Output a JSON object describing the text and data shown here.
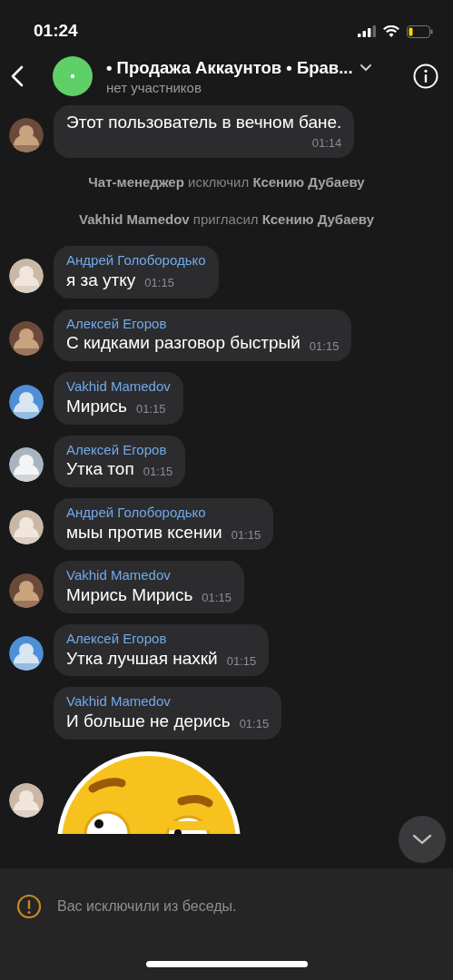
{
  "status_bar": {
    "time": "01:24"
  },
  "header": {
    "title": "• Продажа Аккаунтов • Брав...",
    "subtitle": "нет участников"
  },
  "messages": [
    {
      "kind": "text",
      "text": "Этот пользователь в вечном бане.",
      "time": "01:14",
      "show_avatar": true
    },
    {
      "kind": "system",
      "text": "**Чат-менеджер** исключил **Ксению Дубаеву**"
    },
    {
      "kind": "system",
      "text": "**Vakhid Mamedov** пригласил **Ксению Дубаеву**"
    },
    {
      "kind": "text",
      "sender": "Андрей Голобородько",
      "text": "я за утку",
      "time": "01:15",
      "show_avatar": true
    },
    {
      "kind": "text",
      "sender": "Алексей Егоров",
      "text": "С кидками разговор быстрый",
      "time": "01:15",
      "show_avatar": true
    },
    {
      "kind": "text",
      "sender": "Vakhid Mamedov",
      "text": "Мирись",
      "time": "01:15",
      "show_avatar": true
    },
    {
      "kind": "text",
      "sender": "Алексей Егоров",
      "text": "Утка топ",
      "time": "01:15",
      "show_avatar": true
    },
    {
      "kind": "text",
      "sender": "Андрей Голобородько",
      "text": "мыы против ксении",
      "time": "01:15",
      "show_avatar": true
    },
    {
      "kind": "text",
      "sender": "Vakhid Mamedov",
      "text": "Мирись Мирись",
      "time": "01:15",
      "show_avatar": true
    },
    {
      "kind": "text",
      "sender": "Алексей Егоров",
      "text": "Утка лучшая нахкй",
      "time": "01:15",
      "show_avatar": true
    },
    {
      "kind": "text",
      "sender": "Vakhid Mamedov",
      "text": "И больше не дерись",
      "time": "01:15",
      "show_avatar": false
    },
    {
      "kind": "sticker",
      "show_avatar": true
    }
  ],
  "notice": {
    "text": "Вас исключили из беседы."
  }
}
